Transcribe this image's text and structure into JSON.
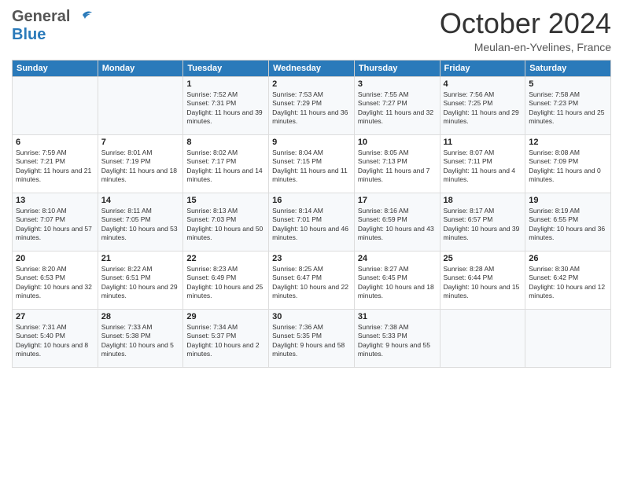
{
  "logo": {
    "line1": "General",
    "line2": "Blue"
  },
  "title": "October 2024",
  "subtitle": "Meulan-en-Yvelines, France",
  "columns": [
    "Sunday",
    "Monday",
    "Tuesday",
    "Wednesday",
    "Thursday",
    "Friday",
    "Saturday"
  ],
  "weeks": [
    [
      {
        "day": "",
        "sunrise": "",
        "sunset": "",
        "daylight": ""
      },
      {
        "day": "",
        "sunrise": "",
        "sunset": "",
        "daylight": ""
      },
      {
        "day": "1",
        "sunrise": "Sunrise: 7:52 AM",
        "sunset": "Sunset: 7:31 PM",
        "daylight": "Daylight: 11 hours and 39 minutes."
      },
      {
        "day": "2",
        "sunrise": "Sunrise: 7:53 AM",
        "sunset": "Sunset: 7:29 PM",
        "daylight": "Daylight: 11 hours and 36 minutes."
      },
      {
        "day": "3",
        "sunrise": "Sunrise: 7:55 AM",
        "sunset": "Sunset: 7:27 PM",
        "daylight": "Daylight: 11 hours and 32 minutes."
      },
      {
        "day": "4",
        "sunrise": "Sunrise: 7:56 AM",
        "sunset": "Sunset: 7:25 PM",
        "daylight": "Daylight: 11 hours and 29 minutes."
      },
      {
        "day": "5",
        "sunrise": "Sunrise: 7:58 AM",
        "sunset": "Sunset: 7:23 PM",
        "daylight": "Daylight: 11 hours and 25 minutes."
      }
    ],
    [
      {
        "day": "6",
        "sunrise": "Sunrise: 7:59 AM",
        "sunset": "Sunset: 7:21 PM",
        "daylight": "Daylight: 11 hours and 21 minutes."
      },
      {
        "day": "7",
        "sunrise": "Sunrise: 8:01 AM",
        "sunset": "Sunset: 7:19 PM",
        "daylight": "Daylight: 11 hours and 18 minutes."
      },
      {
        "day": "8",
        "sunrise": "Sunrise: 8:02 AM",
        "sunset": "Sunset: 7:17 PM",
        "daylight": "Daylight: 11 hours and 14 minutes."
      },
      {
        "day": "9",
        "sunrise": "Sunrise: 8:04 AM",
        "sunset": "Sunset: 7:15 PM",
        "daylight": "Daylight: 11 hours and 11 minutes."
      },
      {
        "day": "10",
        "sunrise": "Sunrise: 8:05 AM",
        "sunset": "Sunset: 7:13 PM",
        "daylight": "Daylight: 11 hours and 7 minutes."
      },
      {
        "day": "11",
        "sunrise": "Sunrise: 8:07 AM",
        "sunset": "Sunset: 7:11 PM",
        "daylight": "Daylight: 11 hours and 4 minutes."
      },
      {
        "day": "12",
        "sunrise": "Sunrise: 8:08 AM",
        "sunset": "Sunset: 7:09 PM",
        "daylight": "Daylight: 11 hours and 0 minutes."
      }
    ],
    [
      {
        "day": "13",
        "sunrise": "Sunrise: 8:10 AM",
        "sunset": "Sunset: 7:07 PM",
        "daylight": "Daylight: 10 hours and 57 minutes."
      },
      {
        "day": "14",
        "sunrise": "Sunrise: 8:11 AM",
        "sunset": "Sunset: 7:05 PM",
        "daylight": "Daylight: 10 hours and 53 minutes."
      },
      {
        "day": "15",
        "sunrise": "Sunrise: 8:13 AM",
        "sunset": "Sunset: 7:03 PM",
        "daylight": "Daylight: 10 hours and 50 minutes."
      },
      {
        "day": "16",
        "sunrise": "Sunrise: 8:14 AM",
        "sunset": "Sunset: 7:01 PM",
        "daylight": "Daylight: 10 hours and 46 minutes."
      },
      {
        "day": "17",
        "sunrise": "Sunrise: 8:16 AM",
        "sunset": "Sunset: 6:59 PM",
        "daylight": "Daylight: 10 hours and 43 minutes."
      },
      {
        "day": "18",
        "sunrise": "Sunrise: 8:17 AM",
        "sunset": "Sunset: 6:57 PM",
        "daylight": "Daylight: 10 hours and 39 minutes."
      },
      {
        "day": "19",
        "sunrise": "Sunrise: 8:19 AM",
        "sunset": "Sunset: 6:55 PM",
        "daylight": "Daylight: 10 hours and 36 minutes."
      }
    ],
    [
      {
        "day": "20",
        "sunrise": "Sunrise: 8:20 AM",
        "sunset": "Sunset: 6:53 PM",
        "daylight": "Daylight: 10 hours and 32 minutes."
      },
      {
        "day": "21",
        "sunrise": "Sunrise: 8:22 AM",
        "sunset": "Sunset: 6:51 PM",
        "daylight": "Daylight: 10 hours and 29 minutes."
      },
      {
        "day": "22",
        "sunrise": "Sunrise: 8:23 AM",
        "sunset": "Sunset: 6:49 PM",
        "daylight": "Daylight: 10 hours and 25 minutes."
      },
      {
        "day": "23",
        "sunrise": "Sunrise: 8:25 AM",
        "sunset": "Sunset: 6:47 PM",
        "daylight": "Daylight: 10 hours and 22 minutes."
      },
      {
        "day": "24",
        "sunrise": "Sunrise: 8:27 AM",
        "sunset": "Sunset: 6:45 PM",
        "daylight": "Daylight: 10 hours and 18 minutes."
      },
      {
        "day": "25",
        "sunrise": "Sunrise: 8:28 AM",
        "sunset": "Sunset: 6:44 PM",
        "daylight": "Daylight: 10 hours and 15 minutes."
      },
      {
        "day": "26",
        "sunrise": "Sunrise: 8:30 AM",
        "sunset": "Sunset: 6:42 PM",
        "daylight": "Daylight: 10 hours and 12 minutes."
      }
    ],
    [
      {
        "day": "27",
        "sunrise": "Sunrise: 7:31 AM",
        "sunset": "Sunset: 5:40 PM",
        "daylight": "Daylight: 10 hours and 8 minutes."
      },
      {
        "day": "28",
        "sunrise": "Sunrise: 7:33 AM",
        "sunset": "Sunset: 5:38 PM",
        "daylight": "Daylight: 10 hours and 5 minutes."
      },
      {
        "day": "29",
        "sunrise": "Sunrise: 7:34 AM",
        "sunset": "Sunset: 5:37 PM",
        "daylight": "Daylight: 10 hours and 2 minutes."
      },
      {
        "day": "30",
        "sunrise": "Sunrise: 7:36 AM",
        "sunset": "Sunset: 5:35 PM",
        "daylight": "Daylight: 9 hours and 58 minutes."
      },
      {
        "day": "31",
        "sunrise": "Sunrise: 7:38 AM",
        "sunset": "Sunset: 5:33 PM",
        "daylight": "Daylight: 9 hours and 55 minutes."
      },
      {
        "day": "",
        "sunrise": "",
        "sunset": "",
        "daylight": ""
      },
      {
        "day": "",
        "sunrise": "",
        "sunset": "",
        "daylight": ""
      }
    ]
  ]
}
